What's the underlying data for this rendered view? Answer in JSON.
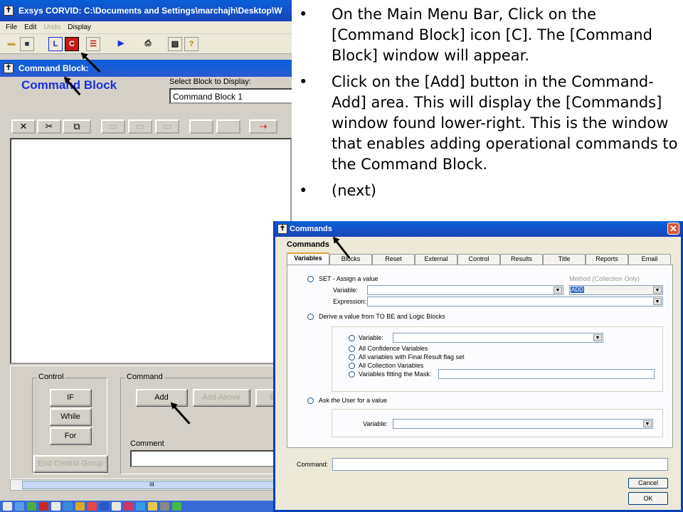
{
  "main_window": {
    "title": "Exsys CORVID: C:\\Documents and Settings\\marchajh\\Desktop\\W",
    "menu": [
      "File",
      "Edit",
      "Undo",
      "Display"
    ],
    "disabled_menu": "Undo",
    "toolbar_icons": [
      "open-icon",
      "save-icon",
      "logic-block-icon",
      "command-block-icon",
      "list-icon",
      "run-icon",
      "print-icon",
      "properties-icon",
      "help-icon"
    ],
    "toolbar_glyphs": {
      "logic": "L",
      "command": "C",
      "help": "?"
    }
  },
  "command_block_window": {
    "title": "Command Block:",
    "heading": "Command Block",
    "select_label": "Select Block to Display:",
    "select_value": "Command Block 1"
  },
  "lower_panel": {
    "control_label": "Control",
    "if_label": "IF",
    "while_label": "While",
    "for_label": "For",
    "end_control_label": "End Control Group",
    "command_label": "Command",
    "add_label": "Add",
    "add_above_label": "Add Above",
    "partial_label": "E",
    "comment_label": "Comment",
    "scroll_grip": "III"
  },
  "bullets": [
    "On the Main Menu Bar, Click on the [Command Block] icon [C].  The [Command Block] window will appear.",
    "Click on the [Add] button in the Command-Add] area.  This will display the [Commands] window found lower-right.  This is the window that enables adding operational commands to the Command Block.",
    "(next)"
  ],
  "bullet_char": "•",
  "commands_window": {
    "title": "Commands",
    "close": "✕",
    "heading": "Commands",
    "tabs": [
      "Variables",
      "Blocks",
      "Reset",
      "External",
      "Control",
      "Results",
      "Title",
      "Reports",
      "Email"
    ],
    "active_tab": "Variables",
    "set_label": "SET - Assign a value",
    "variable_label": "Variable:",
    "expression_label": "Expression:",
    "method_label": "Method (Collection Only)",
    "method_value": "ADD",
    "derive_label": "Derive a value from TO BE and Logic Blocks",
    "sub_variable_label": "Variable:",
    "all_confidence": "All Confidence Variables",
    "all_final": "All variables with Final Result flag set",
    "all_collection": "All Collection Variables",
    "mask_label": "Variables fitting the Mask:",
    "ask_label": "Ask the User for a value",
    "ask_variable_label": "Variable:",
    "command_label": "Command:",
    "cancel_label": "Cancel",
    "ok_label": "OK"
  },
  "colors": {
    "titlebar": "#0a5fd8",
    "heading_blue": "#1a2fe0",
    "dialog_bg": "#ece9d8",
    "close_red": "#d85a3a"
  }
}
